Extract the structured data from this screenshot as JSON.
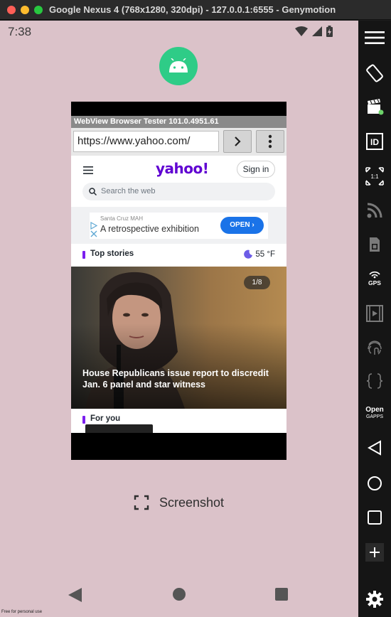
{
  "window": {
    "title": "Google Nexus 4 (768x1280, 320dpi) - 127.0.0.1:6555 - Genymotion"
  },
  "status_bar": {
    "time": "7:38"
  },
  "webview": {
    "title": "WebView Browser Tester 101.0.4951.61",
    "url": "https://www.yahoo.com/"
  },
  "yahoo": {
    "logo": "yahoo!",
    "signin_label": "Sign in",
    "search_placeholder": "Search the web",
    "ad": {
      "sponsor": "Santa Cruz MAH",
      "text": "A retrospective exhibition",
      "cta": "OPEN"
    },
    "top_stories_label": "Top stories",
    "weather": "55 °F",
    "hero": {
      "counter": "1/8",
      "headline": "House Republicans issue report to discredit Jan. 6 panel and star witness"
    },
    "for_you_label": "For you"
  },
  "screenshot_label": "Screenshot",
  "watermark": "Free for personal use",
  "toolbar": {
    "icons": [
      "menu-icon",
      "rotate-icon",
      "video-clapper-icon",
      "id-icon",
      "fullscreen-icon",
      "rss-icon",
      "sim-card-icon",
      "gps-icon",
      "film-icon",
      "fingerprint-icon",
      "braces-icon",
      "open-gapps-icon",
      "back-icon",
      "home-icon",
      "recents-icon",
      "add-icon",
      "settings-icon"
    ],
    "gps_label": "GPS",
    "id_label": "ID",
    "ratio_label": "1:1",
    "open_label": "Open",
    "gapps_label": "GAPPS"
  }
}
